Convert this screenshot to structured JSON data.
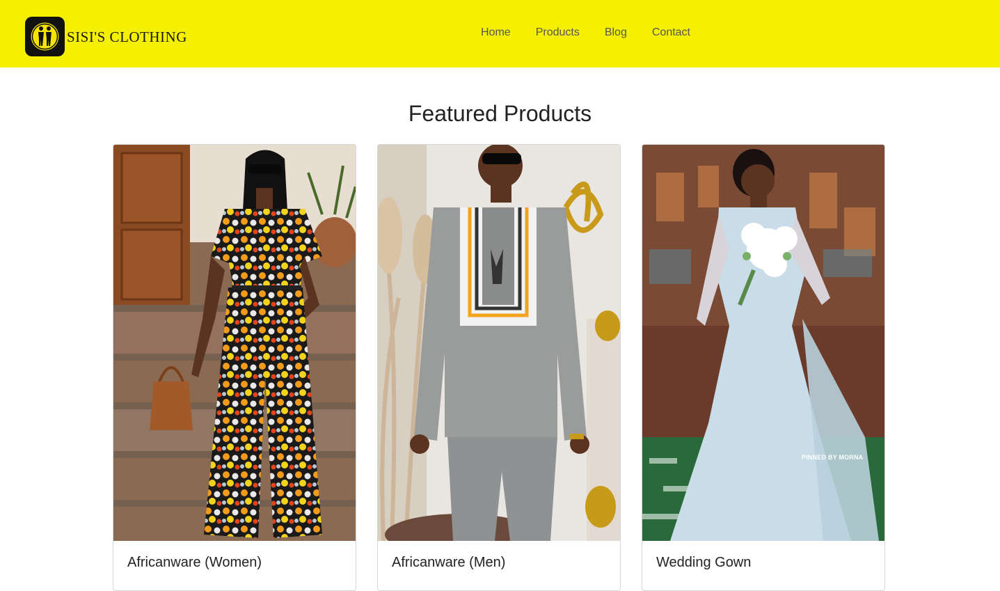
{
  "brand": {
    "name": "SISI'S CLOTHING"
  },
  "nav": {
    "items": [
      "Home",
      "Products",
      "Blog",
      "Contact"
    ]
  },
  "featured": {
    "title": "Featured Products",
    "products": [
      {
        "title": "Africanware (Women)",
        "image_icon": "woman-print-outfit-photo"
      },
      {
        "title": "Africanware (Men)",
        "image_icon": "man-senator-outfit-photo"
      },
      {
        "title": "Wedding Gown",
        "image_icon": "bride-wedding-gown-photo",
        "watermark": "PINNED BY MORNA"
      }
    ]
  },
  "colors": {
    "header_bg": "#f5f000",
    "logo_bg": "#111111",
    "logo_accent": "#f5e400"
  }
}
